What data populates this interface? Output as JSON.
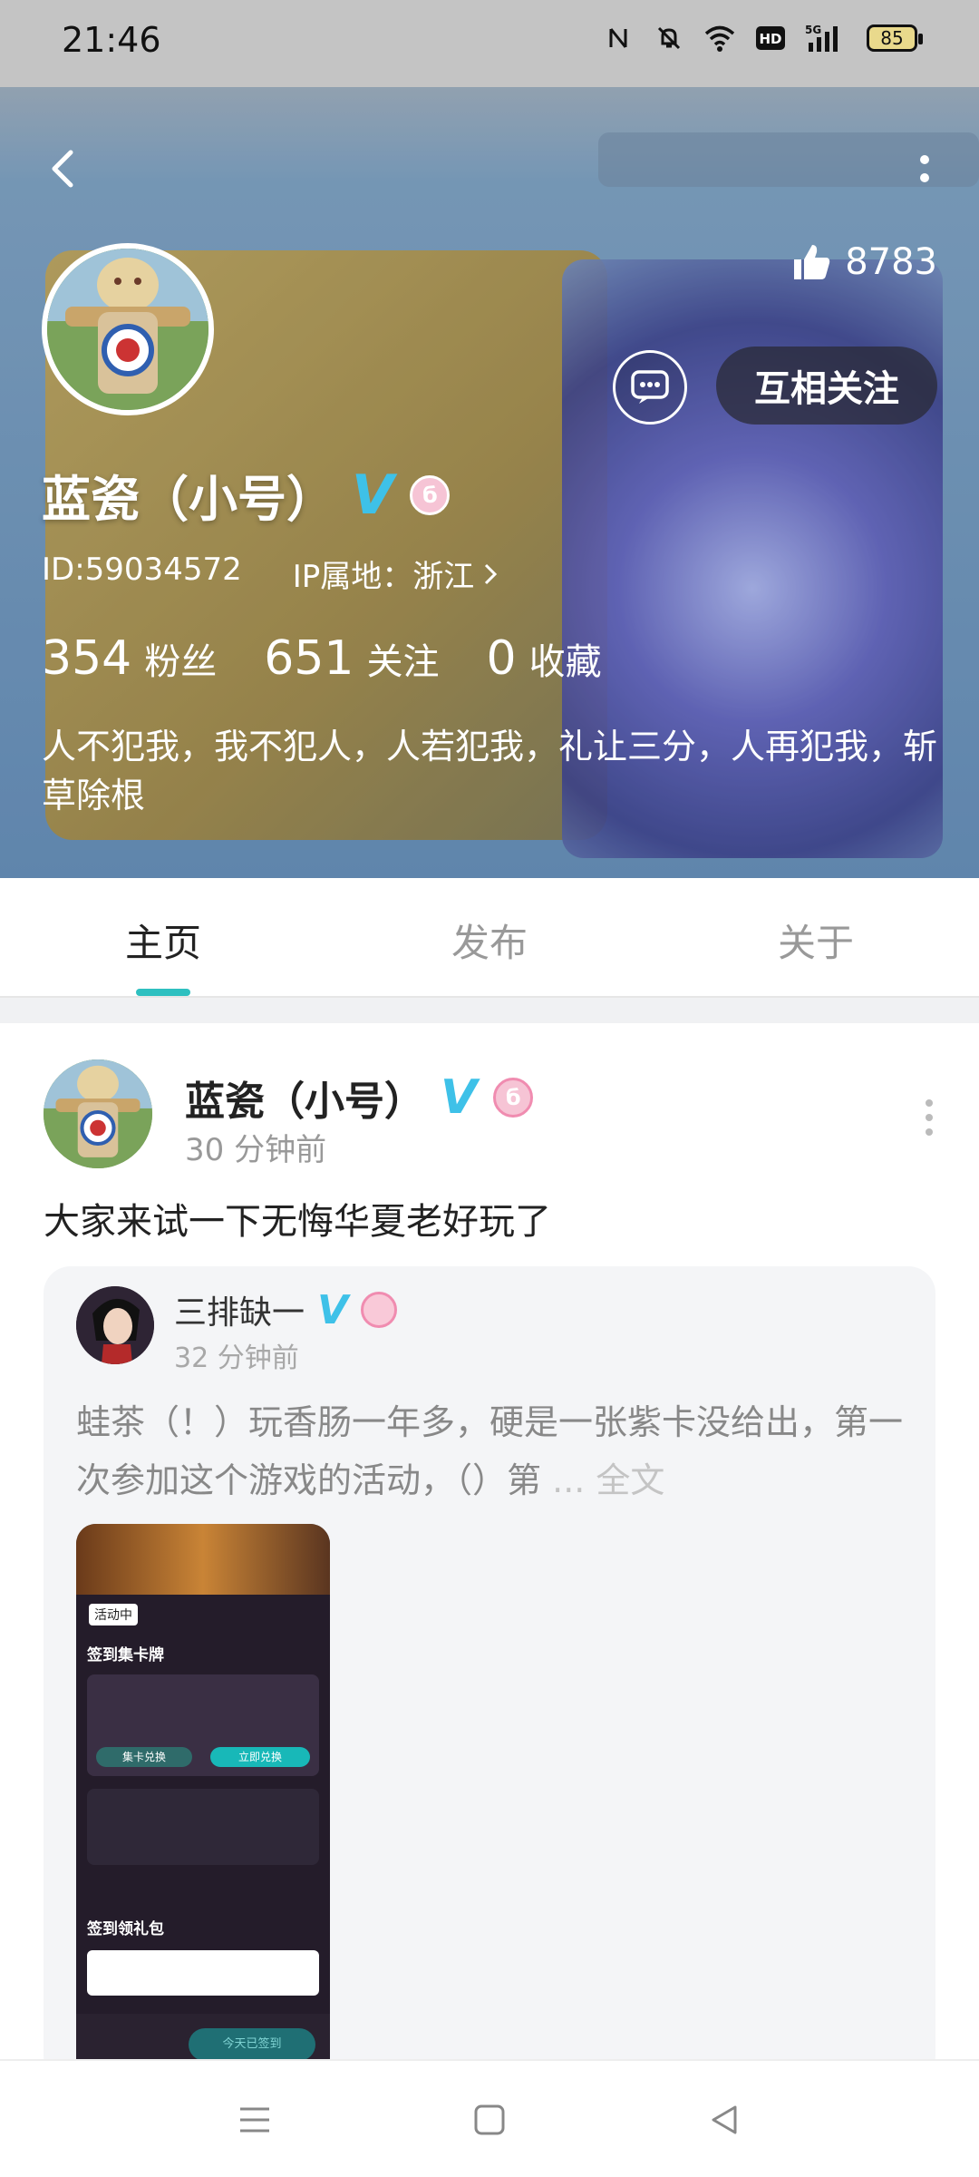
{
  "status_bar": {
    "time": "21:46",
    "battery": "85",
    "icons": [
      "nfc-icon",
      "mute-icon",
      "wifi-icon",
      "hd-icon",
      "signal-5g-icon",
      "battery-icon"
    ]
  },
  "profile": {
    "likes": "8783",
    "follow_button": "互相关注",
    "username": "蓝瓷（小号）",
    "v_badge": "V",
    "level_badge": "б",
    "id": "ID:59034572",
    "ip_location": "IP属地：浙江",
    "stats": [
      {
        "value": "354",
        "label": "粉丝"
      },
      {
        "value": "651",
        "label": "关注"
      },
      {
        "value": "0",
        "label": "收藏"
      }
    ],
    "bio": "人不犯我，我不犯人，人若犯我，礼让三分，人再犯我，斩草除根",
    "accent_color": "#2ec0c0"
  },
  "tabs": [
    {
      "label": "主页",
      "active": true
    },
    {
      "label": "发布",
      "active": false
    },
    {
      "label": "关于",
      "active": false
    }
  ],
  "post": {
    "author": "蓝瓷（小号）",
    "v_badge": "V",
    "level_badge": "б",
    "time": "30 分钟前",
    "text": "大家来试一下无悔华夏老好玩了",
    "quote": {
      "author": "三排缺一",
      "v_badge": "V",
      "time": "32 分钟前",
      "text": "蛙茶（！）玩香肠一年多，硬是一张紫卡没给出，第一次参加这个游戏的活动，（）第",
      "more": "... 全文",
      "image": {
        "tag": "活动中",
        "heading1": "签到集卡牌",
        "heading2": "签到领礼包",
        "btn1": "集卡兑换",
        "btn2": "立即兑换",
        "sign_button": "今天已签到"
      }
    }
  }
}
